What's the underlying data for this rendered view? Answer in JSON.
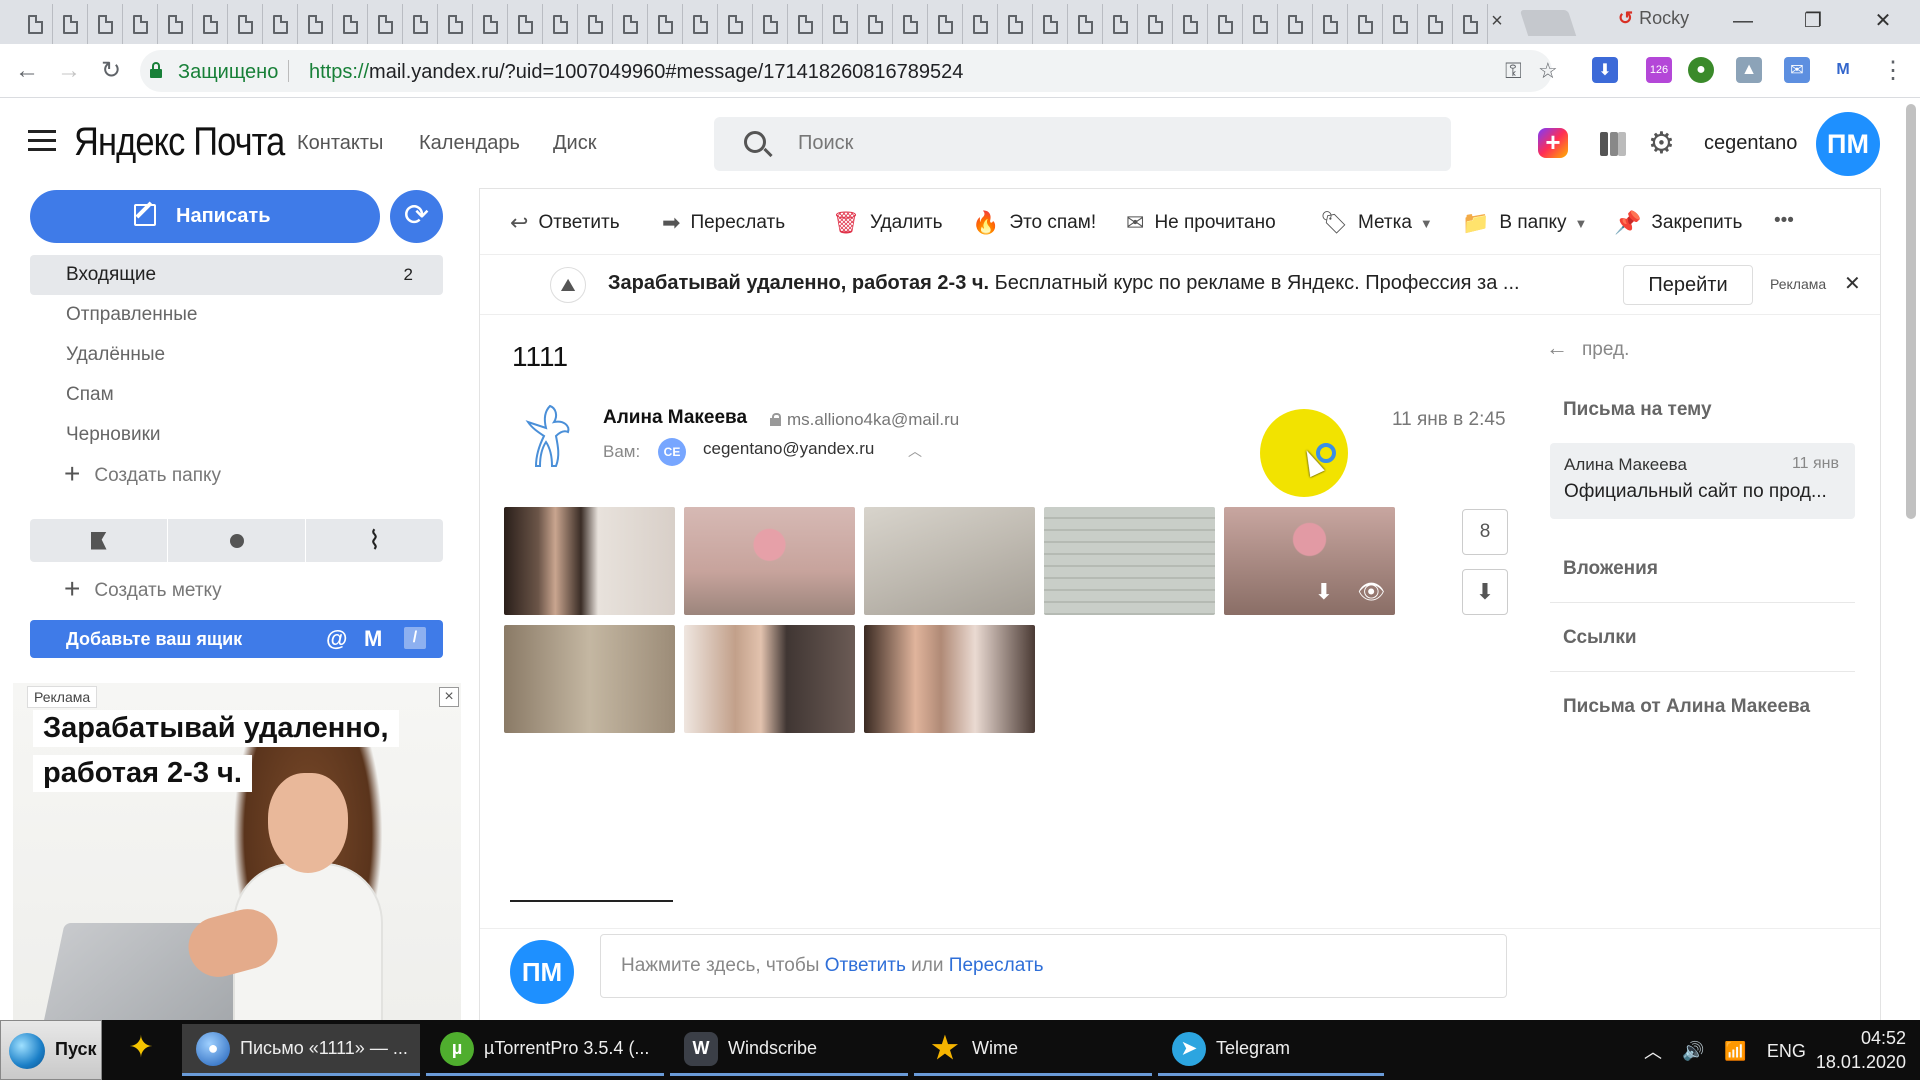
{
  "browser": {
    "tab_count": 42,
    "tab_close": "×",
    "profile_name": "Rocky",
    "window_controls": {
      "minimize": "—",
      "restore": "❐",
      "close": "✕"
    },
    "secure_label": "Защищено",
    "url_proto": "https://",
    "url_rest": "mail.yandex.ru/?uid=1007049960#message/171418260816789524",
    "extension_badge": "126"
  },
  "header": {
    "logo": "Яндекс Почта",
    "services": [
      "Контакты",
      "Календарь",
      "Диск"
    ],
    "search_placeholder": "Поиск",
    "username": "cegentano",
    "avatar_initials": "ПМ"
  },
  "sidebar": {
    "compose_label": "Написать",
    "folders": [
      {
        "label": "Входящие",
        "count": "2",
        "active": true
      },
      {
        "label": "Отправленные",
        "count": ""
      },
      {
        "label": "Удалённые",
        "count": ""
      },
      {
        "label": "Спам",
        "count": ""
      },
      {
        "label": "Черновики",
        "count": ""
      }
    ],
    "create_folder": "Создать папку",
    "create_label": "Создать метку",
    "add_mailbox": "Добавьте ваш ящик"
  },
  "left_ad": {
    "tag": "Реклама",
    "line1": "Зарабатывай удаленно,",
    "line2": "работая 2-3 ч."
  },
  "toolbar": {
    "reply": "Ответить",
    "forward": "Переслать",
    "delete": "Удалить",
    "spam": "Это спам!",
    "unread": "Не прочитано",
    "label": "Метка",
    "to_folder": "В папку",
    "pin": "Закрепить",
    "more": "•••"
  },
  "ad_banner": {
    "bold": "Зарабатывай удаленно, работая 2-3 ч.",
    "text": " Бесплатный курс по рекламе в Яндекс. Профессия за ...",
    "button": "Перейти",
    "tag": "Реклама"
  },
  "message": {
    "subject": "1111",
    "from_name": "Алина Макеева",
    "from_email": "ms.alliono4ka@mail.ru",
    "to_label": "Вам:",
    "to_badge": "CE",
    "to_email": "cegentano@yandex.ru",
    "date": "11 янв в 2:45",
    "attachments_count": "8"
  },
  "right_panel": {
    "prev": "пред.",
    "thread_heading": "Письма на тему",
    "thread_from": "Алина Макеева",
    "thread_date": "11 янв",
    "thread_subject": "Официальный сайт по прод...",
    "attachments": "Вложения",
    "links": "Ссылки",
    "from_sender": "Письма от Алина Макеева"
  },
  "reply": {
    "avatar": "ПМ",
    "prefix": "Нажмите здесь, чтобы ",
    "reply_link": "Ответить",
    "or": " или ",
    "forward_link": "Переслать"
  },
  "taskbar": {
    "start": "Пуск",
    "tasks": [
      {
        "label": "Письмо «1111» — ...",
        "active": true
      },
      {
        "label": "µTorrentPro 3.5.4  (..."
      },
      {
        "label": "Windscribe"
      },
      {
        "label": "Wime"
      },
      {
        "label": "Telegram"
      }
    ],
    "lang": "ENG",
    "time": "04:52",
    "date": "18.01.2020"
  },
  "colors": {
    "accent": "#3f7be8",
    "avatar": "#1e90ff",
    "secure_green": "#188038"
  }
}
